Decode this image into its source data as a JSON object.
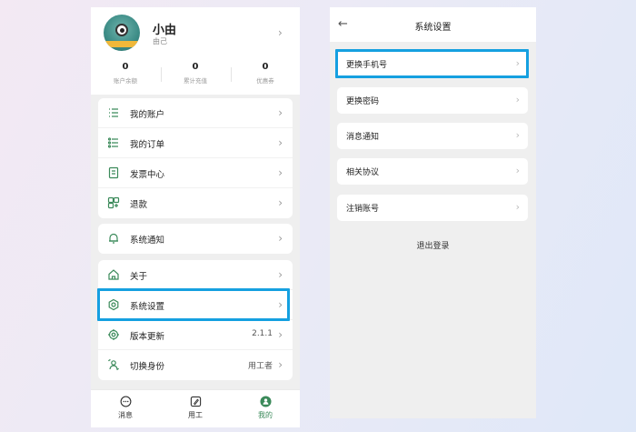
{
  "left": {
    "profile": {
      "name": "小由",
      "subname": "由己",
      "stats": [
        {
          "value": "0",
          "label": "账户余额"
        },
        {
          "value": "0",
          "label": "累计充值"
        },
        {
          "value": "0",
          "label": "优惠券"
        }
      ]
    },
    "group1": [
      {
        "label": "我的账户",
        "icon": "list-icon"
      },
      {
        "label": "我的订单",
        "icon": "order-list-icon"
      },
      {
        "label": "发票中心",
        "icon": "invoice-icon"
      },
      {
        "label": "退款",
        "icon": "refund-icon"
      }
    ],
    "group2": [
      {
        "label": "系统通知",
        "icon": "bell-icon"
      }
    ],
    "group3": [
      {
        "label": "关于",
        "icon": "home-icon",
        "value": ""
      },
      {
        "label": "系统设置",
        "icon": "settings-icon",
        "value": ""
      },
      {
        "label": "版本更新",
        "icon": "update-gear-icon",
        "value": "2.1.1"
      },
      {
        "label": "切换身份",
        "icon": "switch-user-icon",
        "value": "用工者"
      }
    ],
    "tabs": [
      {
        "label": "消息",
        "icon": "message-icon",
        "active": false
      },
      {
        "label": "用工",
        "icon": "work-icon",
        "active": false
      },
      {
        "label": "我的",
        "icon": "profile-icon",
        "active": true
      }
    ]
  },
  "right": {
    "title": "系统设置",
    "items": [
      {
        "label": "更换手机号"
      },
      {
        "label": "更换密码"
      },
      {
        "label": "消息通知"
      },
      {
        "label": "相关协议"
      },
      {
        "label": "注销账号"
      }
    ],
    "logout": "退出登录"
  },
  "colors": {
    "accent_green": "#3b8a5a",
    "highlight_blue": "#15a0e0"
  }
}
